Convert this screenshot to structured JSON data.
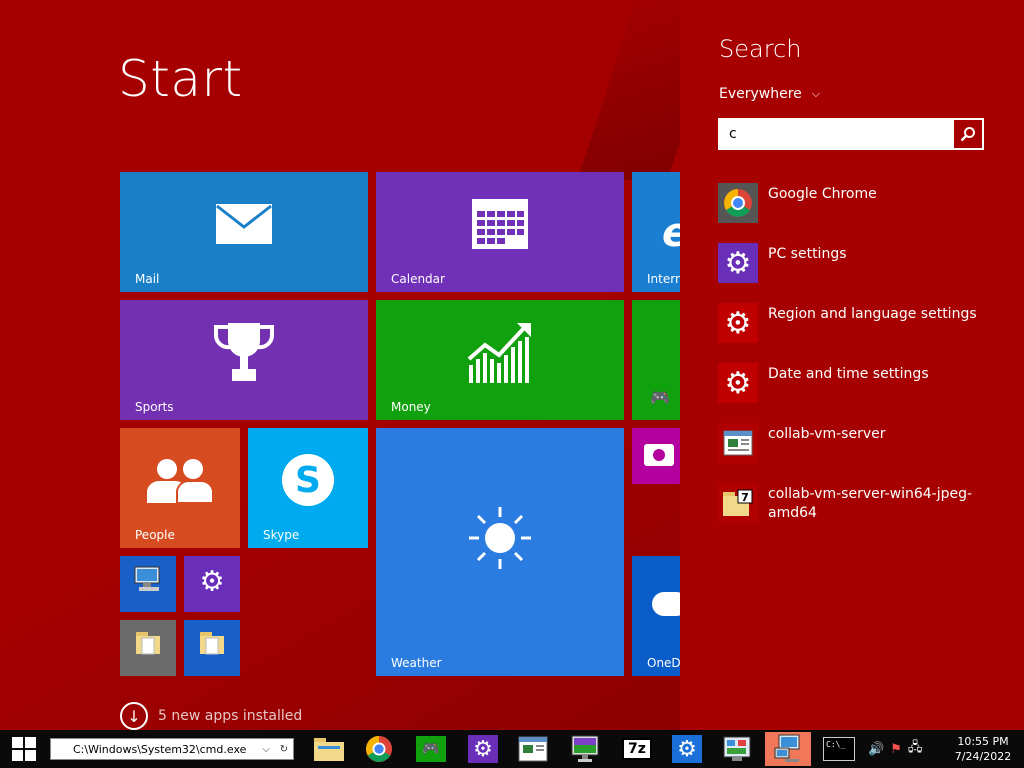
{
  "start": {
    "title": "Start",
    "tiles": {
      "mail": "Mail",
      "calendar": "Calendar",
      "ie": "Intern",
      "sports": "Sports",
      "money": "Money",
      "people": "People",
      "skype": "Skype",
      "weather": "Weather",
      "onedrive": "OneD"
    },
    "new_apps": "5 new apps installed"
  },
  "search": {
    "title": "Search",
    "scope": "Everywhere",
    "query": "c",
    "results": [
      {
        "label": "Google Chrome",
        "icon": "chrome-icon"
      },
      {
        "label": "PC settings",
        "icon": "gear-icon"
      },
      {
        "label": "Region and language settings",
        "icon": "gear-icon"
      },
      {
        "label": "Date and time settings",
        "icon": "gear-icon"
      },
      {
        "label": "collab-vm-server",
        "icon": "app-window-icon"
      },
      {
        "label": "collab-vm-server-win64-jpeg-amd64",
        "icon": "7zip-folder-icon"
      }
    ]
  },
  "taskbar": {
    "address": "C:\\Windows\\System32\\cmd.exe",
    "clock_time": "10:55 PM",
    "clock_date": "7/24/2022"
  },
  "colors": {
    "background": "#a70000",
    "mail": "#1b7fc8",
    "calendar": "#7130b8",
    "sports": "#7330b0",
    "money": "#12a10e",
    "people": "#d64b20",
    "skype": "#00aaef",
    "weather": "#2a7ce0"
  }
}
